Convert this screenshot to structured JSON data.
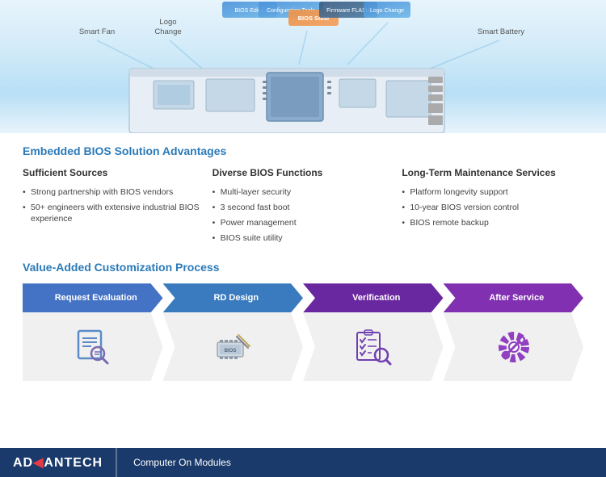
{
  "diagram": {
    "labels": {
      "smart_fan": "Smart Fan",
      "logo_change_left": "Logo\nChange",
      "logo_change_right": "Logo Change",
      "smart_battery": "Smart Battery",
      "bios_suite": "BIOS Suite",
      "bios_editor": "BIOS Editor",
      "config_tools": "Configuration Tools",
      "firmware_flash": "Firmware FLASH"
    }
  },
  "section1": {
    "title": "Embedded BIOS Solution Advantages",
    "col1": {
      "heading": "Sufficient Sources",
      "items": [
        "Strong partnership with BIOS vendors",
        "50+ engineers with extensive industrial BIOS experience"
      ]
    },
    "col2": {
      "heading": "Diverse BIOS Functions",
      "items": [
        "Multi-layer security",
        "3 second fast boot",
        "Power management",
        "BIOS suite utility"
      ]
    },
    "col3": {
      "heading": "Long-Term Maintenance Services",
      "items": [
        "Platform longevity support",
        "10-year BIOS version control",
        "BIOS remote backup"
      ]
    }
  },
  "section2": {
    "title": "Value-Added Customization Process",
    "steps": [
      {
        "label": "Request Evaluation",
        "color": "blue",
        "icon": "search-document"
      },
      {
        "label": "RD Design",
        "color": "blue2",
        "icon": "bios-chip"
      },
      {
        "label": "Verification",
        "color": "purple",
        "icon": "checklist-search"
      },
      {
        "label": "After Service",
        "color": "purple2",
        "icon": "wrench-gear"
      }
    ]
  },
  "footer": {
    "brand": "AD",
    "brand_highlight": "ANTECH",
    "subtitle": "Computer On Modules"
  }
}
